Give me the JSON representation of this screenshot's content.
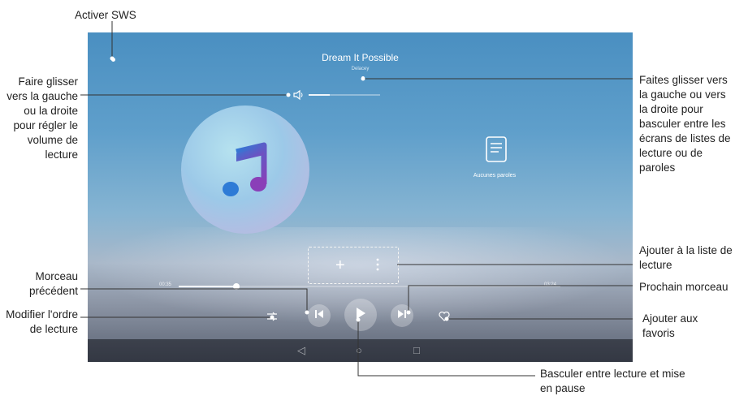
{
  "player": {
    "song_title": "Dream It Possible",
    "artist": "Delacey",
    "lyrics_placeholder": "Aucunes paroles",
    "elapsed": "00:35",
    "duration": "03:24",
    "progress_fraction": 0.15,
    "volume_fraction": 0.3
  },
  "annotations": {
    "activate_sws": "Activer SWS",
    "volume": "Faire glisser vers la gauche ou la droite pour régler le volume de lecture",
    "swipe_screens": "Faites glisser vers la gauche ou vers la droite pour basculer entre les écrans de listes de lecture ou de paroles",
    "add_playlist": "Ajouter à la liste de lecture",
    "previous": "Morceau précédent",
    "next": "Prochain morceau",
    "shuffle": "Modifier l'ordre de lecture",
    "favorite": "Ajouter aux favoris",
    "play_pause": "Basculer entre lecture et mise en pause"
  },
  "icons": {
    "music": "music-note-icon",
    "volume": "speaker-icon",
    "lyrics": "document-icon",
    "add": "plus-icon",
    "more": "more-vertical-icon",
    "previous": "skip-previous-icon",
    "play": "play-icon",
    "next": "skip-next-icon",
    "shuffle": "shuffle-icon",
    "favorite": "heart-icon"
  }
}
